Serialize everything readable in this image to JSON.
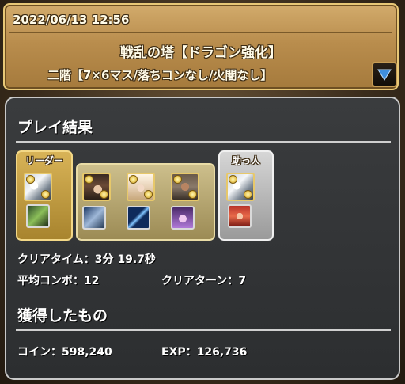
{
  "header": {
    "datetime": "2022/06/13 12:56",
    "dungeon_title": "戦乱の塔【ドラゴン強化】",
    "floor_info": "二階【7×6マス/落ちコンなし/火闇なし】",
    "toggle_icon": "down-triangle-icon"
  },
  "result": {
    "section_title": "プレイ結果",
    "team": {
      "leader_label": "リーダー",
      "helper_label": "助っ人",
      "members": [
        {
          "role": "leader",
          "icon": "white-dragon-monster-icon",
          "assist_icon": "green-weapon-assist-icon"
        },
        {
          "role": "sub1",
          "icon": "witch-monster-icon",
          "assist_icon": "blue-dragon-assist-icon"
        },
        {
          "role": "sub2",
          "icon": "goddess-monster-icon",
          "assist_icon": "blue-spear-assist-icon"
        },
        {
          "role": "sub3",
          "icon": "bearded-man-monster-icon",
          "assist_icon": "purple-creature-assist-icon"
        },
        {
          "role": "helper",
          "icon": "white-dragon-monster-icon",
          "assist_icon": "red-hair-girl-assist-icon"
        }
      ]
    },
    "clear_time_label": "クリアタイム：",
    "clear_time_value": "3分 19.7秒",
    "avg_combo_label": "平均コンボ：",
    "avg_combo_value": "12",
    "clear_turn_label": "クリアターン：",
    "clear_turn_value": "7"
  },
  "rewards": {
    "section_title": "獲得したもの",
    "coin_label": "コイン：",
    "coin_value": "598,240",
    "exp_label": "EXP：",
    "exp_value": "126,736"
  },
  "colors": {
    "header_gold": "#b98d4d",
    "panel_bg": "#333537",
    "leader_frame": "#d8b357",
    "helper_frame": "#d6d6d6",
    "toggle_arrow": "#3f8fe0"
  }
}
